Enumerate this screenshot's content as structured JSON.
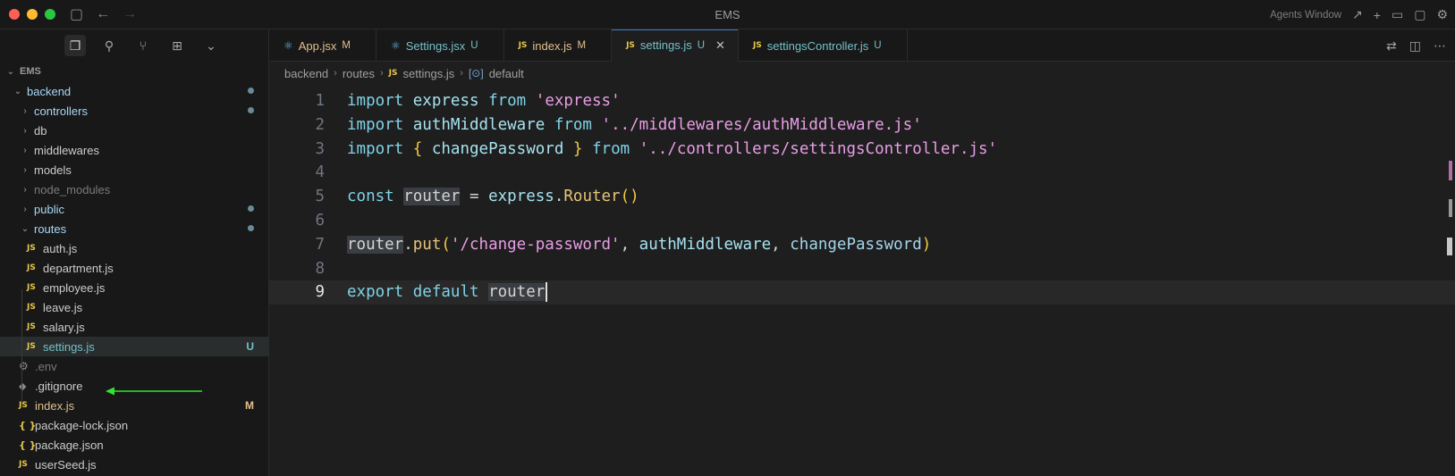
{
  "window": {
    "title": "EMS",
    "agents_window": "Agents Window"
  },
  "sidebar": {
    "root": "EMS",
    "items": [
      {
        "label": "backend",
        "kind": "folder-open",
        "depth": 1,
        "color": "blue",
        "status": "dot"
      },
      {
        "label": "controllers",
        "kind": "folder",
        "depth": 2,
        "color": "blue",
        "status": "dot"
      },
      {
        "label": "db",
        "kind": "folder",
        "depth": 2,
        "color": "normal",
        "status": ""
      },
      {
        "label": "middlewares",
        "kind": "folder",
        "depth": 2,
        "color": "normal",
        "status": ""
      },
      {
        "label": "models",
        "kind": "folder",
        "depth": 2,
        "color": "normal",
        "status": ""
      },
      {
        "label": "node_modules",
        "kind": "folder",
        "depth": 2,
        "color": "dim",
        "status": ""
      },
      {
        "label": "public",
        "kind": "folder",
        "depth": 2,
        "color": "blue",
        "status": "dot"
      },
      {
        "label": "routes",
        "kind": "folder-open",
        "depth": 2,
        "color": "blue",
        "status": "dot"
      },
      {
        "label": "auth.js",
        "kind": "js",
        "depth": 3,
        "color": "normal",
        "status": ""
      },
      {
        "label": "department.js",
        "kind": "js",
        "depth": 3,
        "color": "normal",
        "status": ""
      },
      {
        "label": "employee.js",
        "kind": "js",
        "depth": 3,
        "color": "normal",
        "status": ""
      },
      {
        "label": "leave.js",
        "kind": "js",
        "depth": 3,
        "color": "normal",
        "status": ""
      },
      {
        "label": "salary.js",
        "kind": "js",
        "depth": 3,
        "color": "normal",
        "status": ""
      },
      {
        "label": "settings.js",
        "kind": "js",
        "depth": 3,
        "color": "teal",
        "status": "U",
        "selected": true
      },
      {
        "label": ".env",
        "kind": "gear",
        "depth": 2,
        "color": "dim",
        "status": ""
      },
      {
        "label": ".gitignore",
        "kind": "git",
        "depth": 2,
        "color": "normal",
        "status": ""
      },
      {
        "label": "index.js",
        "kind": "js",
        "depth": 2,
        "color": "yellow",
        "status": "M"
      },
      {
        "label": "package-lock.json",
        "kind": "json",
        "depth": 2,
        "color": "normal",
        "status": ""
      },
      {
        "label": "package.json",
        "kind": "json",
        "depth": 2,
        "color": "normal",
        "status": ""
      },
      {
        "label": "userSeed.js",
        "kind": "js",
        "depth": 2,
        "color": "normal",
        "status": ""
      }
    ]
  },
  "tabs": [
    {
      "name": "App.jsx",
      "status": "M",
      "icon": "react",
      "active": false
    },
    {
      "name": "Settings.jsx",
      "status": "U",
      "icon": "react",
      "active": false
    },
    {
      "name": "index.js",
      "status": "M",
      "icon": "js",
      "active": false
    },
    {
      "name": "settings.js",
      "status": "U",
      "icon": "js",
      "active": true
    },
    {
      "name": "settingsController.js",
      "status": "U",
      "icon": "js",
      "active": false
    }
  ],
  "breadcrumb": {
    "parts": [
      "backend",
      "routes",
      "settings.js",
      "default"
    ],
    "js_label": "JS"
  },
  "icon_labels": {
    "js": "JS",
    "json": "{ }"
  },
  "editor": {
    "current_line": 9,
    "lines": [
      {
        "n": "1",
        "tokens": [
          [
            "k",
            "import"
          ],
          [
            "p",
            " "
          ],
          [
            "v",
            "express"
          ],
          [
            "p",
            " "
          ],
          [
            "k",
            "from"
          ],
          [
            "p",
            " "
          ],
          [
            "s",
            "'express'"
          ]
        ]
      },
      {
        "n": "2",
        "tokens": [
          [
            "k",
            "import"
          ],
          [
            "p",
            " "
          ],
          [
            "v",
            "authMiddleware"
          ],
          [
            "p",
            " "
          ],
          [
            "k",
            "from"
          ],
          [
            "p",
            " "
          ],
          [
            "s",
            "'../middlewares/authMiddleware.js'"
          ]
        ]
      },
      {
        "n": "3",
        "tokens": [
          [
            "k",
            "import"
          ],
          [
            "p",
            " "
          ],
          [
            "b",
            "{"
          ],
          [
            "p",
            " "
          ],
          [
            "v",
            "changePassword"
          ],
          [
            "p",
            " "
          ],
          [
            "b",
            "}"
          ],
          [
            "p",
            " "
          ],
          [
            "k",
            "from"
          ],
          [
            "p",
            " "
          ],
          [
            "s",
            "'../controllers/settingsController.js'"
          ]
        ]
      },
      {
        "n": "4",
        "tokens": []
      },
      {
        "n": "5",
        "tokens": [
          [
            "k",
            "const"
          ],
          [
            "p",
            " "
          ],
          [
            "hl",
            "router"
          ],
          [
            "p",
            " = "
          ],
          [
            "v",
            "express"
          ],
          [
            "p",
            "."
          ],
          [
            "i",
            "Router"
          ],
          [
            "b",
            "()"
          ]
        ]
      },
      {
        "n": "6",
        "tokens": []
      },
      {
        "n": "7",
        "tokens": [
          [
            "hl",
            "router"
          ],
          [
            "p",
            "."
          ],
          [
            "i",
            "put"
          ],
          [
            "b",
            "("
          ],
          [
            "s",
            "'/change-password'"
          ],
          [
            "p",
            ", "
          ],
          [
            "v",
            "authMiddleware"
          ],
          [
            "p",
            ", "
          ],
          [
            "var",
            "changePassword"
          ],
          [
            "b",
            ")"
          ]
        ]
      },
      {
        "n": "8",
        "tokens": []
      },
      {
        "n": "9",
        "tokens": [
          [
            "k",
            "export"
          ],
          [
            "p",
            " "
          ],
          [
            "k",
            "default"
          ],
          [
            "p",
            " "
          ],
          [
            "hl",
            "router"
          ]
        ]
      }
    ]
  }
}
